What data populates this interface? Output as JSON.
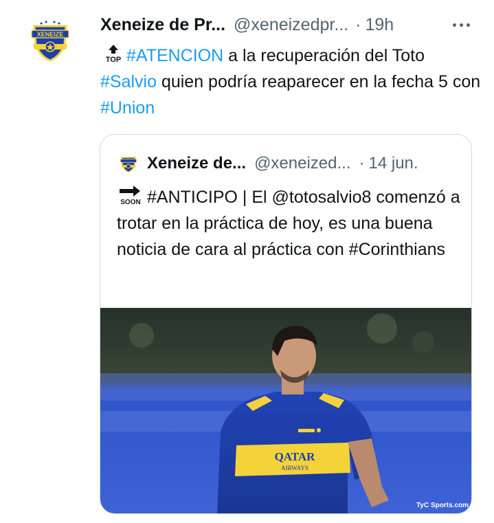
{
  "tweet": {
    "author_name": "Xeneize de Pr...",
    "handle": "@xeneizedpr...",
    "separator": "·",
    "time": "19h",
    "body": {
      "hashtag1": "#ATENCION",
      "text1": " a la recuperación del Toto ",
      "hashtag2": "#Salvio",
      "text2": " quien podría reaparecer en la fecha 5 con ",
      "hashtag3": "#Union"
    },
    "avatar_text": "XENEIZE",
    "emoji_top_label": "TOP"
  },
  "quoted": {
    "author_name": "Xeneize de...",
    "handle": "@xeneized...",
    "separator": "·",
    "time": "14 jun.",
    "text": "#ANTICIPO | El @totosalvio8 comenzó a trotar en la práctica de hoy, es una buena noticia de cara al práctica con #Corinthians",
    "emoji_soon_label": "SOON",
    "media": {
      "shirt_text_1": "QATAR",
      "shirt_text_2": "AIRWAYS",
      "watermark": "TyC Sports.com"
    }
  },
  "colors": {
    "link": "#1d9bf0",
    "text": "#0f1419",
    "secondary": "#536471",
    "border": "#cfd9de",
    "boca_blue": "#1c3fa8",
    "boca_yellow": "#f4d23a"
  },
  "icons": [
    "more-icon",
    "top-arrow-emoji",
    "soon-arrow-emoji"
  ]
}
